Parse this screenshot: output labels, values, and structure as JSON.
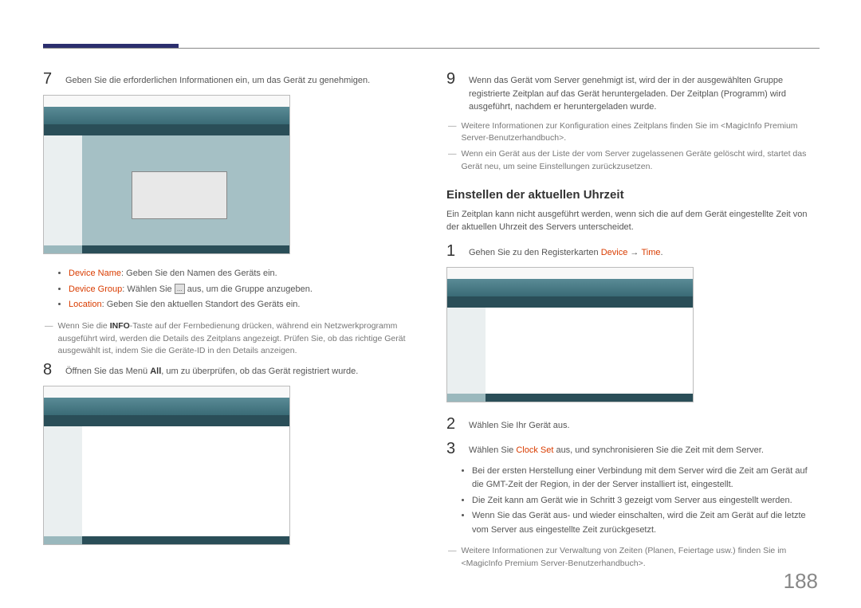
{
  "page_number": "188",
  "left": {
    "step7": {
      "num": "7",
      "text": "Geben Sie die erforderlichen Informationen ein, um das Gerät zu genehmigen."
    },
    "bullets": [
      {
        "label": "Device Name",
        "text": ": Geben Sie den Namen des Geräts ein."
      },
      {
        "label": "Device Group",
        "text_before": ": Wählen Sie ",
        "text_after": " aus, um die Gruppe anzugeben.",
        "icon": "..."
      },
      {
        "label": "Location",
        "text": ": Geben Sie den aktuellen Standort des Geräts ein."
      }
    ],
    "note1": "Wenn Sie die INFO-Taste auf der Fernbedienung drücken, während ein Netzwerkprogramm ausgeführt wird, werden die Details des Zeitplans angezeigt. Prüfen Sie, ob das richtige Gerät ausgewählt ist, indem Sie die Geräte-ID in den Details anzeigen.",
    "note1_bold": "INFO",
    "step8": {
      "num": "8",
      "text_before": "Öffnen Sie das Menü ",
      "bold": "All",
      "text_after": ", um zu überprüfen, ob das Gerät registriert wurde."
    }
  },
  "right": {
    "step9": {
      "num": "9",
      "text": "Wenn das Gerät vom Server genehmigt ist, wird der in der ausgewählten Gruppe registrierte Zeitplan auf das Gerät heruntergeladen. Der Zeitplan (Programm) wird ausgeführt, nachdem er heruntergeladen wurde."
    },
    "note2": "Weitere Informationen zur Konfiguration eines Zeitplans finden Sie im <MagicInfo Premium Server-Benutzerhandbuch>.",
    "note3": "Wenn ein Gerät aus der Liste der vom Server zugelassenen Geräte gelöscht wird, startet das Gerät neu, um seine Einstellungen zurückzusetzen.",
    "heading": "Einstellen der aktuellen Uhrzeit",
    "intro": "Ein Zeitplan kann nicht ausgeführt werden, wenn sich die auf dem Gerät eingestellte Zeit von der aktuellen Uhrzeit des Servers unterscheidet.",
    "step1": {
      "num": "1",
      "text_before": "Gehen Sie zu den Registerkarten ",
      "hl1": "Device",
      "arrow": " → ",
      "hl2": "Time",
      "text_after": "."
    },
    "step2": {
      "num": "2",
      "text": "Wählen Sie Ihr Gerät aus."
    },
    "step3": {
      "num": "3",
      "text_before": "Wählen Sie ",
      "hl": "Clock Set",
      "text_after": " aus, und synchronisieren Sie die Zeit mit dem Server."
    },
    "bullets2": [
      "Bei der ersten Herstellung einer Verbindung mit dem Server wird die Zeit am Gerät auf die GMT-Zeit der Region, in der der Server installiert ist, eingestellt.",
      "Die Zeit kann am Gerät wie in Schritt 3 gezeigt vom Server aus eingestellt werden.",
      "Wenn Sie das Gerät aus- und wieder einschalten, wird die Zeit am Gerät auf die letzte vom Server aus eingestellte Zeit zurückgesetzt."
    ],
    "note4": "Weitere Informationen zur Verwaltung von Zeiten (Planen, Feiertage usw.) finden Sie im <MagicInfo Premium Server-Benutzerhandbuch>."
  }
}
